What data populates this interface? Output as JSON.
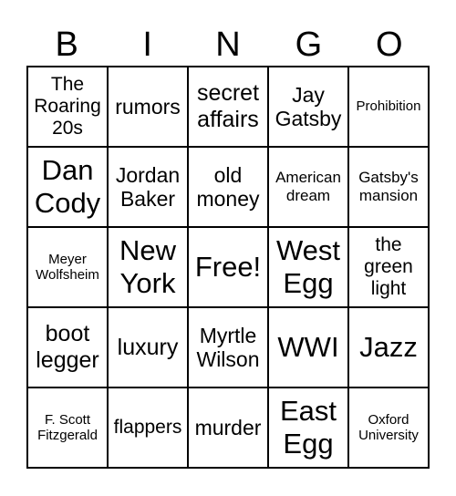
{
  "header": [
    "B",
    "I",
    "N",
    "G",
    "O"
  ],
  "cells": [
    "The Roaring 20s",
    "rumors",
    "secret affairs",
    "Jay Gatsby",
    "Prohibition",
    "Dan Cody",
    "Jordan Baker",
    "old money",
    "American dream",
    "Gatsby's mansion",
    "Meyer Wolfsheim",
    "New York",
    "Free!",
    "West Egg",
    "the green light",
    "boot legger",
    "luxury",
    "Myrtle Wilson",
    "WWI",
    "Jazz",
    "F. Scott Fitzgerald",
    "flappers",
    "murder",
    "East Egg",
    "Oxford University"
  ]
}
